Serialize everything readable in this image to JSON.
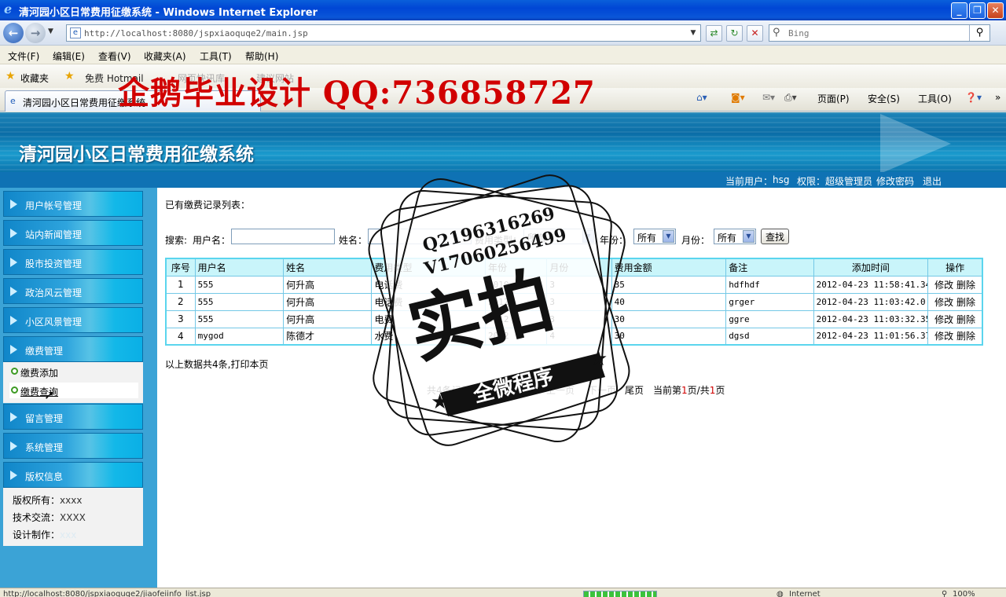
{
  "browser": {
    "window_title": "清河园小区日常费用征缴系统 - Windows Internet Explorer",
    "url": "http://localhost:8080/jspxiaoquqe2/main.jsp",
    "search_placeholder": "Bing",
    "menu": [
      "文件(F)",
      "编辑(E)",
      "查看(V)",
      "收藏夹(A)",
      "工具(T)",
      "帮助(H)"
    ],
    "favorites_label": "收藏夹",
    "favorites_links": [
      "免费 Hotmail",
      "网页快讯库",
      "建议网站"
    ],
    "tab_title": "清河园小区日常费用征缴系统",
    "command_bar": [
      "页面(P)",
      "安全(S)",
      "工具(O)"
    ],
    "status_url": "http://localhost:8080/jspxiaoquqe2/jiaofeiinfo_list.jsp",
    "status_zone": "Internet",
    "status_zoom": "100%"
  },
  "watermark": {
    "top_text": "企鹅毕业设计 QQ:736858727",
    "stamp_line1": "Q2196316269",
    "stamp_line2": "V17060256499",
    "stamp_main": "实拍",
    "stamp_banner": "全微程序"
  },
  "site": {
    "title": "清河园小区日常费用征缴系统",
    "current_user_label": "当前用户：",
    "current_user": "hsg",
    "role_label": "权限：",
    "role": "超级管理员",
    "change_password": "修改密码",
    "logout": "退出"
  },
  "sidebar": {
    "menus": [
      "用户帐号管理",
      "站内新闻管理",
      "股市投资管理",
      "政治风云管理",
      "小区风景管理",
      "缴费管理",
      "留言管理",
      "系统管理",
      "版权信息"
    ],
    "submenu": [
      "缴费添加",
      "缴费查询"
    ],
    "copyright": {
      "owner_label": "版权所有：",
      "owner": "xxxx",
      "tech_label": "技术交流：",
      "tech": "XXXX",
      "design_label": "设计制作：",
      "design": "xxx"
    }
  },
  "content": {
    "list_title": "已有缴费记录列表：",
    "search": {
      "label": "搜索:",
      "username_label": "用户名：",
      "username_value": "",
      "name_label": "姓名：",
      "name_value": "",
      "type_label": "费用类型：",
      "type_value": "所有",
      "year_label": "年份：",
      "year_value": "所有",
      "month_label": "月份：",
      "month_value": "所有",
      "button": "查找"
    },
    "columns": [
      "序号",
      "用户名",
      "姓名",
      "费用类型",
      "年份",
      "月份",
      "费用金额",
      "备注",
      "添加时间",
      "操作"
    ],
    "rows": [
      [
        "1",
        "555",
        "何升高",
        "电话费",
        "2010",
        "3",
        "35",
        "hdfhdf",
        "2012-04-23 11:58:41.34",
        "修改",
        "删除"
      ],
      [
        "2",
        "555",
        "何升高",
        "电话费",
        "2012",
        "3",
        "40",
        "grger",
        "2012-04-23 11:03:42.0",
        "修改",
        "删除"
      ],
      [
        "3",
        "555",
        "何升高",
        "电费",
        "2012",
        "3",
        "30",
        "ggre",
        "2012-04-23 11:03:32.357",
        "修改",
        "删除"
      ],
      [
        "4",
        "mygod",
        "陈德才",
        "水费",
        "2012",
        "4",
        "30",
        "dgsd",
        "2012-04-23 11:01:56.373",
        "修改",
        "删除"
      ]
    ],
    "summary": "以上数据共4条,打印本页",
    "pager": {
      "total": "共4条记录",
      "first": "首页",
      "prev": "上一页",
      "next": "下一页",
      "last": "尾页",
      "current_prefix": "当前第",
      "current_page": "1",
      "page_mid": "页/共",
      "total_pages": "1",
      "page_suffix": "页"
    }
  }
}
